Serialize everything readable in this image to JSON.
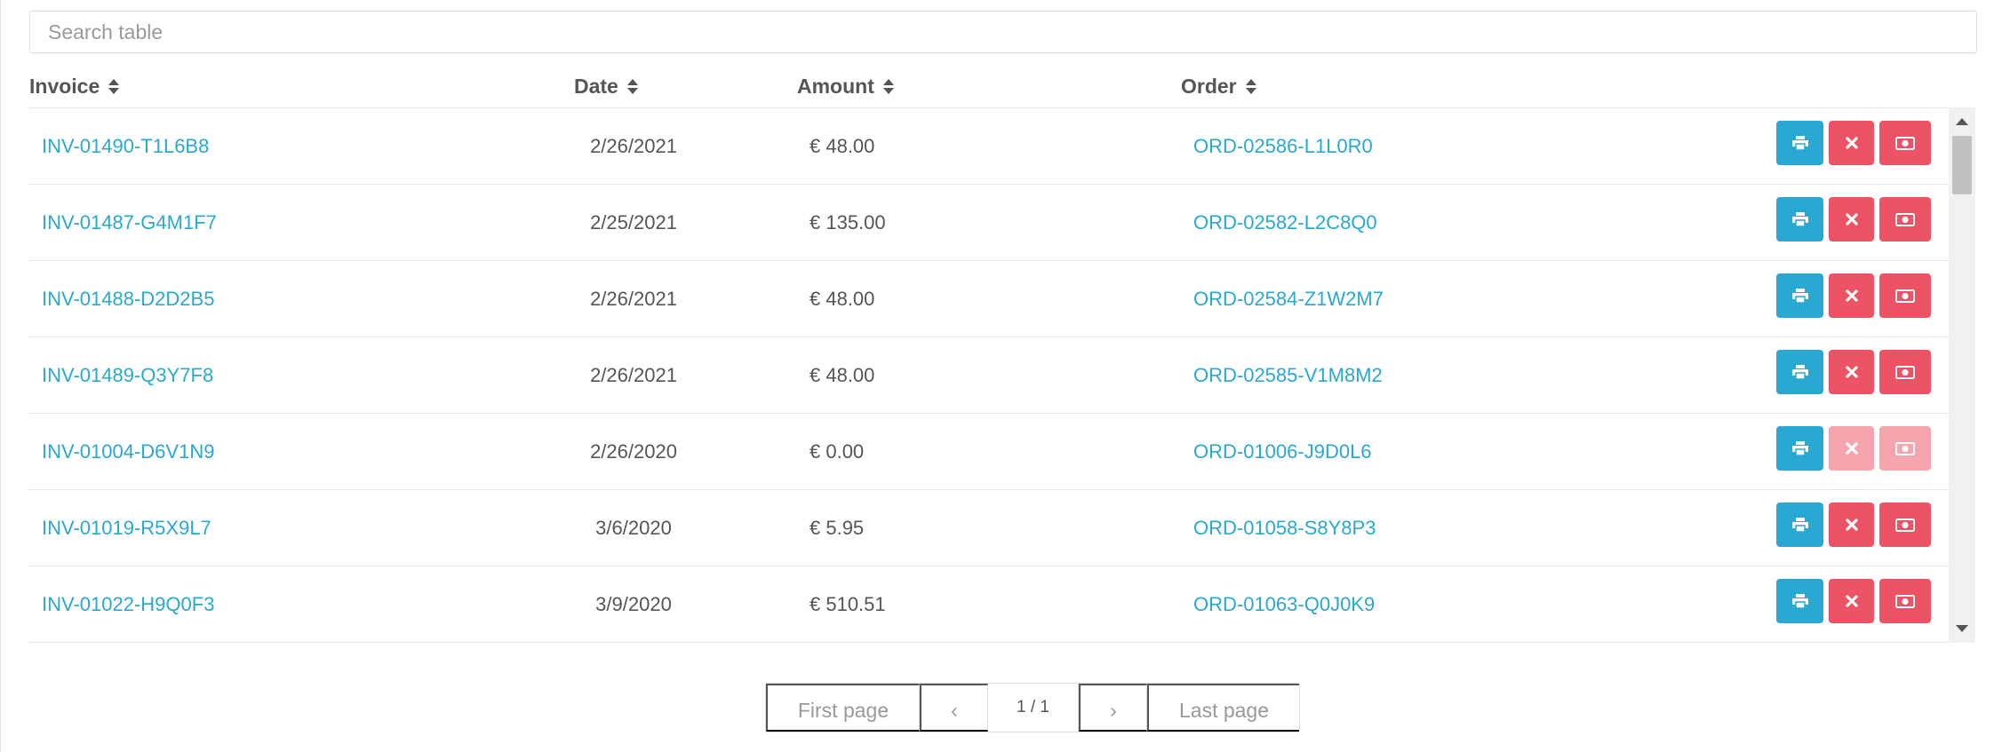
{
  "search": {
    "placeholder": "Search table",
    "value": ""
  },
  "columns": {
    "invoice": "Invoice",
    "date": "Date",
    "amount": "Amount",
    "order": "Order"
  },
  "rows": [
    {
      "invoice": "INV-01490-T1L6B8",
      "date": "2/26/2021",
      "amount": "€ 48.00",
      "order": "ORD-02586-L1L0R0",
      "cancel_enabled": true,
      "refund_enabled": true
    },
    {
      "invoice": "INV-01487-G4M1F7",
      "date": "2/25/2021",
      "amount": "€ 135.00",
      "order": "ORD-02582-L2C8Q0",
      "cancel_enabled": true,
      "refund_enabled": true
    },
    {
      "invoice": "INV-01488-D2D2B5",
      "date": "2/26/2021",
      "amount": "€ 48.00",
      "order": "ORD-02584-Z1W2M7",
      "cancel_enabled": true,
      "refund_enabled": true
    },
    {
      "invoice": "INV-01489-Q3Y7F8",
      "date": "2/26/2021",
      "amount": "€ 48.00",
      "order": "ORD-02585-V1M8M2",
      "cancel_enabled": true,
      "refund_enabled": true
    },
    {
      "invoice": "INV-01004-D6V1N9",
      "date": "2/26/2020",
      "amount": "€ 0.00",
      "order": "ORD-01006-J9D0L6",
      "cancel_enabled": false,
      "refund_enabled": false
    },
    {
      "invoice": "INV-01019-R5X9L7",
      "date": "3/6/2020",
      "amount": "€ 5.95",
      "order": "ORD-01058-S8Y8P3",
      "cancel_enabled": true,
      "refund_enabled": true
    },
    {
      "invoice": "INV-01022-H9Q0F3",
      "date": "3/9/2020",
      "amount": "€ 510.51",
      "order": "ORD-01063-Q0J0K9",
      "cancel_enabled": true,
      "refund_enabled": true
    }
  ],
  "icons": {
    "print": "print-icon",
    "cancel": "close-icon",
    "refund": "money-icon"
  },
  "colors": {
    "link": "#2aa8cf",
    "print": "#29a9d2",
    "danger": "#ec5365",
    "danger_disabled": "#f4a5ae"
  },
  "pagination": {
    "first": "First page",
    "prev": "‹",
    "current": "1 / 1",
    "next": "›",
    "last": "Last page"
  }
}
